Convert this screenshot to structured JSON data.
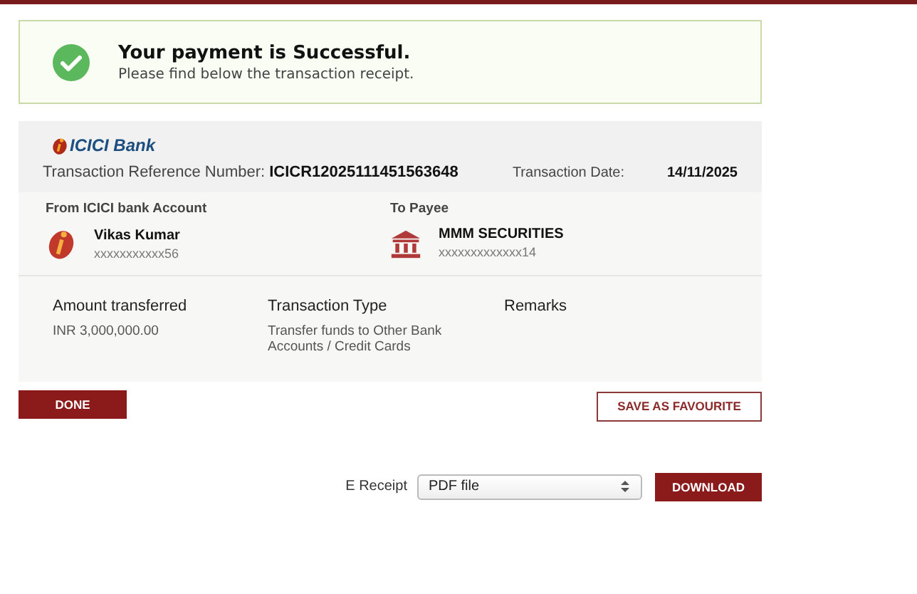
{
  "success": {
    "title": "Your payment is Successful.",
    "message": "Please find below the transaction receipt."
  },
  "receipt": {
    "bank_logo": "ICICI Bank",
    "reference_label": "Transaction Reference Number:",
    "reference_number": "ICICR12025111451563648",
    "date_label": "Transaction Date:",
    "date": "14/11/2025",
    "from": {
      "heading": "From ICICI bank Account",
      "name": "Vikas Kumar",
      "account": "xxxxxxxxxxx56"
    },
    "to": {
      "heading": "To Payee",
      "name": "MMM SECURITIES",
      "account": "xxxxxxxxxxxxx14"
    },
    "details": [
      {
        "label": "Amount transferred",
        "value": "INR 3,000,000.00"
      },
      {
        "label": "Transaction Type",
        "value": "Transfer funds to Other Bank Accounts / Credit Cards"
      },
      {
        "label": "Remarks"
      }
    ]
  },
  "buttons": {
    "done": "DONE",
    "save": "SAVE AS FAVOURITE"
  },
  "e_receipt": {
    "label": "E Receipt",
    "format": "PDF file",
    "download": "DOWNLOAD"
  }
}
